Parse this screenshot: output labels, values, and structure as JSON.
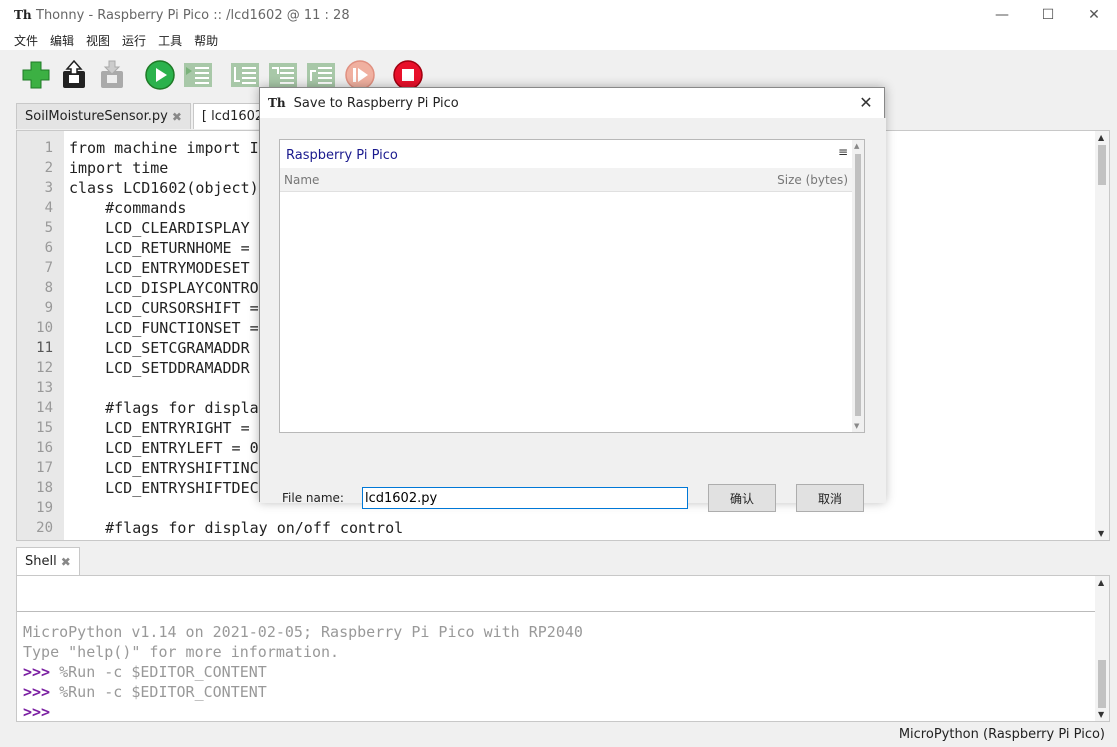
{
  "window": {
    "title": "Thonny  -  Raspberry Pi Pico :: /lcd1602  @  11 : 28",
    "app_icon_text": "Th",
    "minimize": "—",
    "maximize": "☐",
    "close": "✕"
  },
  "menu": [
    "文件",
    "编辑",
    "视图",
    "运行",
    "工具",
    "帮助"
  ],
  "toolbar": {
    "buttons": [
      "new",
      "open",
      "save",
      "run",
      "debug",
      "step-over",
      "step-into",
      "step-out",
      "resume",
      "stop"
    ]
  },
  "tabs": [
    {
      "label": "SoilMoistureSensor.py",
      "close": "✖"
    },
    {
      "label": "[ lcd1602 ]",
      "close": "✖"
    }
  ],
  "editor": {
    "lines": [
      {
        "n": "1",
        "code": "from machine import I"
      },
      {
        "n": "2",
        "code": "import time"
      },
      {
        "n": "3",
        "code": "class LCD1602(object)"
      },
      {
        "n": "4",
        "code": "    #commands"
      },
      {
        "n": "5",
        "code": "    LCD_CLEARDISPLAY"
      },
      {
        "n": "6",
        "code": "    LCD_RETURNHOME ="
      },
      {
        "n": "7",
        "code": "    LCD_ENTRYMODESET"
      },
      {
        "n": "8",
        "code": "    LCD_DISPLAYCONTRO"
      },
      {
        "n": "9",
        "code": "    LCD_CURSORSHIFT ="
      },
      {
        "n": "10",
        "code": "    LCD_FUNCTIONSET ="
      },
      {
        "n": "11",
        "code": "    LCD_SETCGRAMADDR"
      },
      {
        "n": "12",
        "code": "    LCD_SETDDRAMADDR"
      },
      {
        "n": "13",
        "code": ""
      },
      {
        "n": "14",
        "code": "    #flags for displa"
      },
      {
        "n": "15",
        "code": "    LCD_ENTRYRIGHT ="
      },
      {
        "n": "16",
        "code": "    LCD_ENTRYLEFT = 0"
      },
      {
        "n": "17",
        "code": "    LCD_ENTRYSHIFTINC"
      },
      {
        "n": "18",
        "code": "    LCD_ENTRYSHIFTDEC"
      },
      {
        "n": "19",
        "code": ""
      },
      {
        "n": "20",
        "code": "    #flags for display on/off control"
      }
    ]
  },
  "shell": {
    "tab_label": "Shell",
    "tab_close": "✖",
    "lines": [
      {
        "prompt": "",
        "text": "MicroPython v1.14 on 2021-02-05; Raspberry Pi Pico with RP2040"
      },
      {
        "prompt": "",
        "text": "Type \"help()\" for more information."
      },
      {
        "prompt": ">>>",
        "text": " %Run -c $EDITOR_CONTENT"
      },
      {
        "prompt": ">>>",
        "text": " %Run -c $EDITOR_CONTENT"
      },
      {
        "prompt": ">>>",
        "text": ""
      }
    ]
  },
  "status": {
    "interpreter": "MicroPython (Raspberry Pi Pico)"
  },
  "dialog": {
    "title": "Save to Raspberry Pi Pico",
    "close": "✕",
    "location": "Raspberry Pi Pico",
    "menu_glyph": "≡",
    "col_name": "Name",
    "col_size": "Size (bytes)",
    "filename_label": "File name:",
    "filename_value": "lcd1602.py",
    "ok": "确认",
    "cancel": "取消"
  }
}
